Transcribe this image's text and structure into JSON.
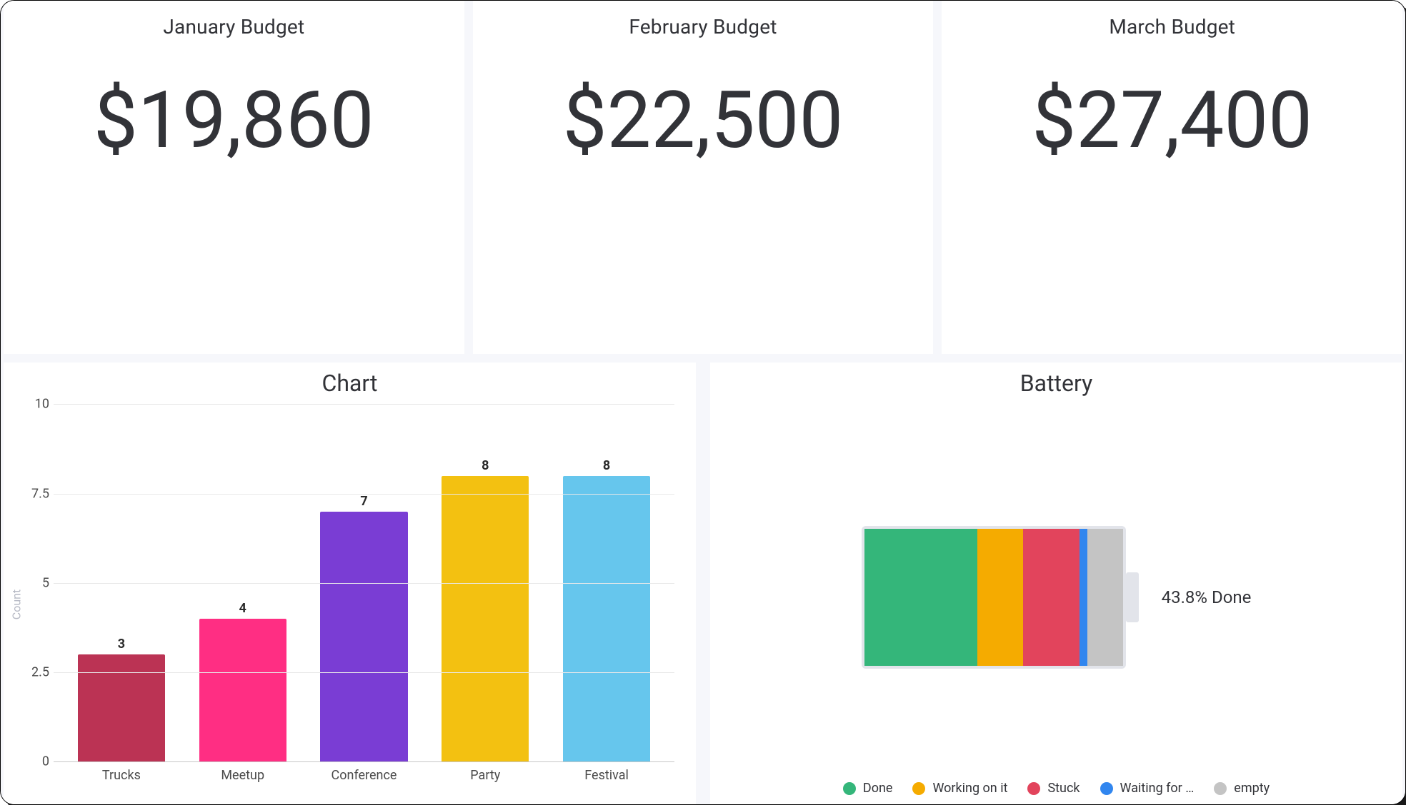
{
  "budgets": [
    {
      "title": "January Budget",
      "value": "$19,860"
    },
    {
      "title": "February Budget",
      "value": "$22,500"
    },
    {
      "title": "March Budget",
      "value": "$27,400"
    }
  ],
  "chart": {
    "title": "Chart",
    "ylabel": "Count"
  },
  "chart_data": [
    {
      "type": "bar",
      "title": "Chart",
      "xlabel": "",
      "ylabel": "Count",
      "ylim": [
        0,
        10
      ],
      "yticks": [
        0,
        2.5,
        5,
        7.5,
        10
      ],
      "categories": [
        "Trucks",
        "Meetup",
        "Conference",
        "Party",
        "Festival"
      ],
      "values": [
        3,
        4,
        7,
        8,
        8
      ],
      "colors": [
        "#bb3354",
        "#ff2e83",
        "#7a3dd4",
        "#f3c111",
        "#66c6ed"
      ]
    },
    {
      "type": "battery",
      "title": "Battery",
      "summary": "43.8% Done",
      "series": [
        {
          "name": "Done",
          "percent": 43.8,
          "color": "#34b67a"
        },
        {
          "name": "Working on it",
          "percent": 17.5,
          "color": "#f5ab00"
        },
        {
          "name": "Stuck",
          "percent": 21.9,
          "color": "#e2445c"
        },
        {
          "name": "Waiting for …",
          "percent": 3.1,
          "color": "#3186ef"
        },
        {
          "name": "empty",
          "percent": 13.7,
          "color": "#c4c4c4"
        }
      ]
    }
  ]
}
